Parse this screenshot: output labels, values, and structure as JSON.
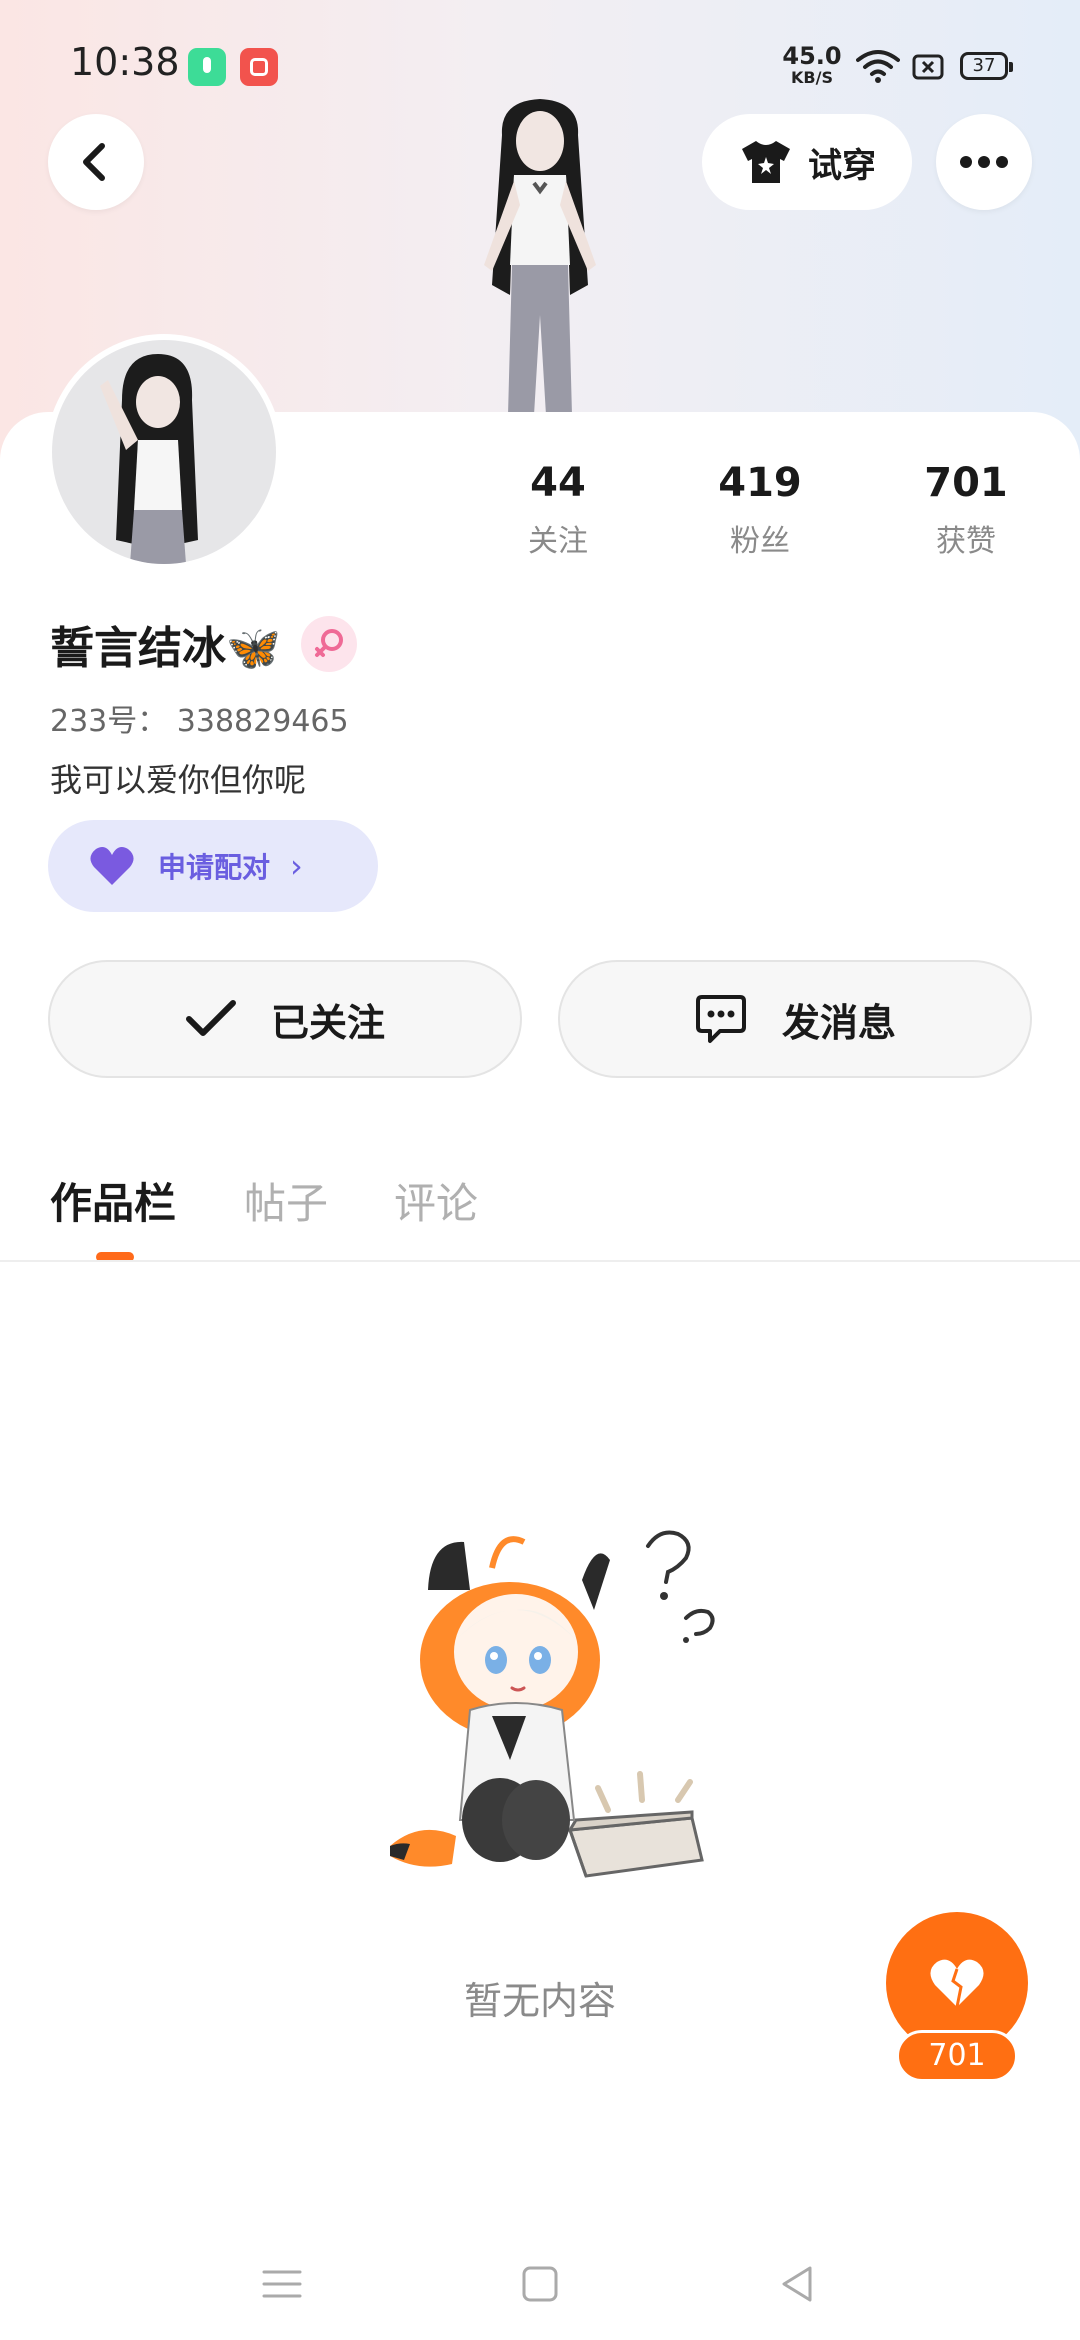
{
  "status_bar": {
    "time": "10:38",
    "net_speed": "45.0",
    "net_unit": "KB/S",
    "battery": "37"
  },
  "header": {
    "try_on_label": "试穿"
  },
  "profile": {
    "nickname": "誓言结冰🦋",
    "gender": "female",
    "uid": "233号： 338829465",
    "bio": "我可以爱你但你呢",
    "pair_label": "申请配对"
  },
  "stats": [
    {
      "value": "44",
      "label": "关注"
    },
    {
      "value": "419",
      "label": "粉丝"
    },
    {
      "value": "701",
      "label": "获赞"
    }
  ],
  "actions": {
    "follow_label": "已关注",
    "message_label": "发消息"
  },
  "tabs": [
    {
      "label": "作品栏",
      "active": true
    },
    {
      "label": "帖子",
      "active": false
    },
    {
      "label": "评论",
      "active": false
    }
  ],
  "empty_state": {
    "text": "暂无内容"
  },
  "like_fab": {
    "count": "701"
  },
  "colors": {
    "accent": "#ff6f12",
    "pair_bg": "#e6e8fb",
    "pair_text": "#6a5ee0"
  }
}
